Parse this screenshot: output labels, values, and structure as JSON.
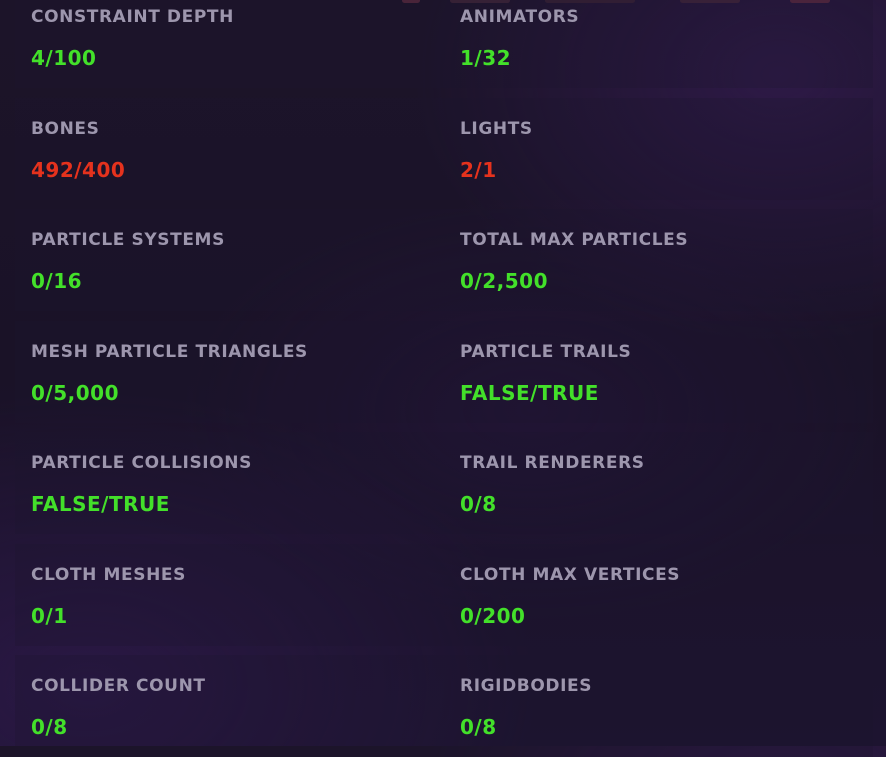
{
  "colors": {
    "ok": "#43e02a",
    "over_limit": "#e5321d",
    "label": "#9d96ad"
  },
  "stats": [
    {
      "label": "CONSTRAINT DEPTH",
      "value": "4/100",
      "status": "ok"
    },
    {
      "label": "ANIMATORS",
      "value": "1/32",
      "status": "ok"
    },
    {
      "label": "BONES",
      "value": "492/400",
      "status": "bad"
    },
    {
      "label": "LIGHTS",
      "value": "2/1",
      "status": "bad"
    },
    {
      "label": "PARTICLE SYSTEMS",
      "value": "0/16",
      "status": "ok"
    },
    {
      "label": "TOTAL MAX PARTICLES",
      "value": "0/2,500",
      "status": "ok"
    },
    {
      "label": "MESH PARTICLE TRIANGLES",
      "value": "0/5,000",
      "status": "ok"
    },
    {
      "label": "PARTICLE TRAILS",
      "value": "FALSE/TRUE",
      "status": "ok"
    },
    {
      "label": "PARTICLE COLLISIONS",
      "value": "FALSE/TRUE",
      "status": "ok"
    },
    {
      "label": "TRAIL RENDERERS",
      "value": "0/8",
      "status": "ok"
    },
    {
      "label": "CLOTH MESHES",
      "value": "0/1",
      "status": "ok"
    },
    {
      "label": "CLOTH MAX VERTICES",
      "value": "0/200",
      "status": "ok"
    },
    {
      "label": "COLLIDER COUNT",
      "value": "0/8",
      "status": "ok"
    },
    {
      "label": "RIGIDBODIES",
      "value": "0/8",
      "status": "ok"
    }
  ]
}
